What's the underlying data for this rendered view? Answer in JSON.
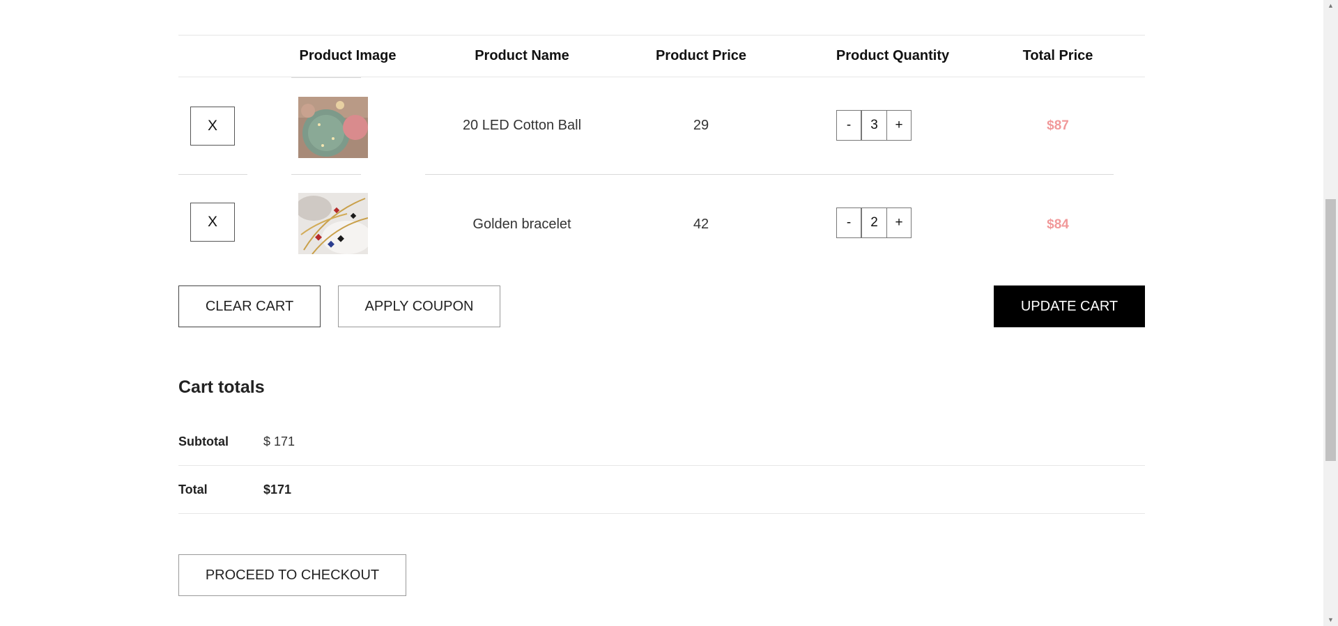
{
  "table": {
    "headers": {
      "image": "Product Image",
      "name": "Product Name",
      "price": "Product Price",
      "quantity": "Product Quantity",
      "total": "Total Price"
    },
    "rows": [
      {
        "remove_label": "X",
        "image_icon": "cotton-ball-lights-thumbnail",
        "name": "20 LED Cotton Ball",
        "price": "29",
        "qty_minus": "-",
        "qty": "3",
        "qty_plus": "+",
        "total": "$87"
      },
      {
        "remove_label": "X",
        "image_icon": "golden-bracelet-thumbnail",
        "name": "Golden bracelet",
        "price": "42",
        "qty_minus": "-",
        "qty": "2",
        "qty_plus": "+",
        "total": "$84"
      }
    ]
  },
  "actions": {
    "clear_cart": "CLEAR CART",
    "apply_coupon": "APPLY COUPON",
    "update_cart": "UPDATE CART"
  },
  "totals": {
    "title": "Cart totals",
    "subtotal_label": "Subtotal",
    "subtotal_value": "$ 171",
    "total_label": "Total",
    "total_value": "$171",
    "checkout": "PROCEED TO CHECKOUT"
  },
  "colors": {
    "total_price": "#f1999a",
    "update_button_bg": "#000000"
  }
}
